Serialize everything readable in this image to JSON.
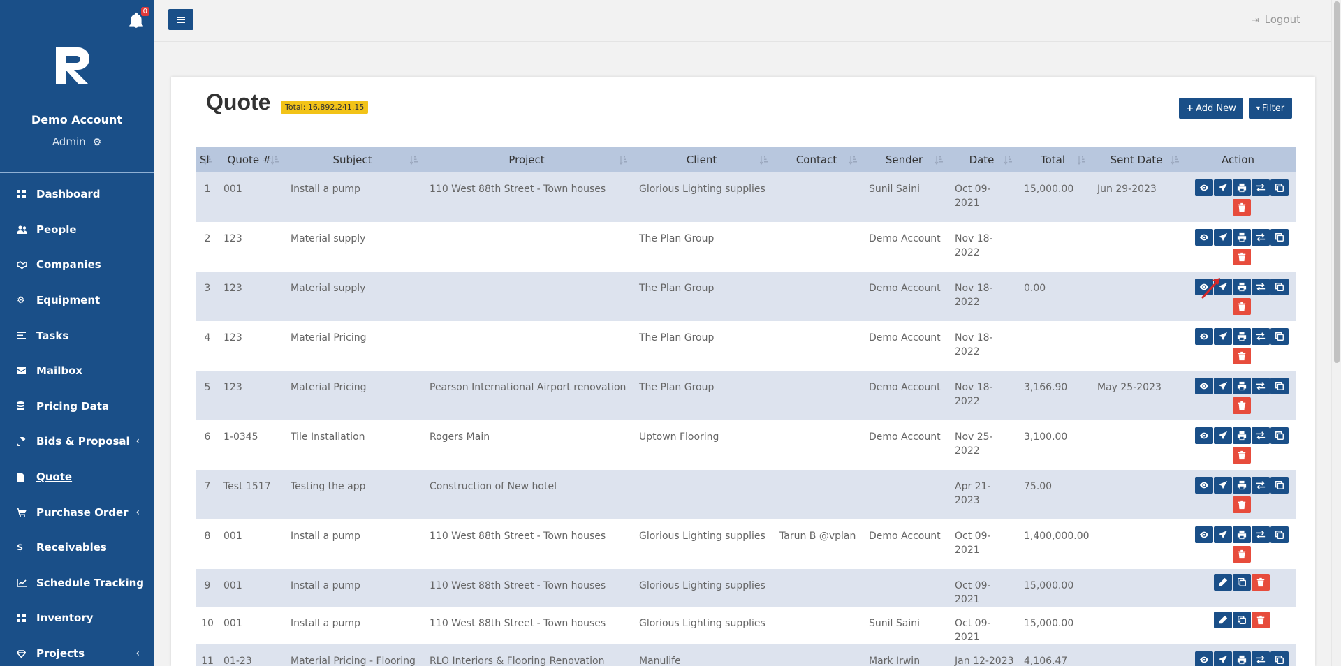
{
  "notifications": {
    "count": "0"
  },
  "account": {
    "name": "Demo Account",
    "role": "Admin"
  },
  "nav": [
    {
      "label": "Dashboard",
      "icon": "dashboard-icon"
    },
    {
      "label": "People",
      "icon": "people-icon"
    },
    {
      "label": "Companies",
      "icon": "handshake-icon"
    },
    {
      "label": "Equipment",
      "icon": "cog-icon"
    },
    {
      "label": "Tasks",
      "icon": "tasks-icon"
    },
    {
      "label": "Mailbox",
      "icon": "envelope-icon"
    },
    {
      "label": "Pricing Data",
      "icon": "database-icon"
    },
    {
      "label": "Bids & Proposal",
      "icon": "gavel-icon",
      "has_submenu": true
    },
    {
      "label": "Quote",
      "icon": "quote-icon",
      "active": true
    },
    {
      "label": "Purchase Order",
      "icon": "cart-icon",
      "has_submenu": true
    },
    {
      "label": "Receivables",
      "icon": "dollar-icon"
    },
    {
      "label": "Schedule Tracking",
      "icon": "chart-line-icon"
    },
    {
      "label": "Inventory",
      "icon": "grid-icon"
    },
    {
      "label": "Projects",
      "icon": "diamond-icon",
      "has_submenu": true
    }
  ],
  "topbar": {
    "logout_label": "Logout"
  },
  "page": {
    "title": "Quote",
    "total_label": "Total: 16,892,241.15",
    "add_new_label": "Add New",
    "filter_label": "Filter"
  },
  "table": {
    "columns": [
      "Sl",
      "Quote #",
      "Subject",
      "Project",
      "Client",
      "Contact",
      "Sender",
      "Date",
      "Total",
      "Sent Date",
      "Action"
    ],
    "rows": [
      {
        "sl": "1",
        "quote": "001",
        "subject": "Install a pump",
        "project": "110 West 88th Street - Town houses",
        "client": "Glorious Lighting supplies",
        "contact": "",
        "sender": "Sunil Saini",
        "date": "Oct 09-2021",
        "total": "15,000.00",
        "sent_date": "Jun 29-2023",
        "actions": "full"
      },
      {
        "sl": "2",
        "quote": "123",
        "subject": "Material supply",
        "project": "",
        "client": "The Plan Group",
        "contact": "",
        "sender": "Demo Account",
        "date": "Nov 18-2022",
        "total": "",
        "sent_date": "",
        "actions": "full"
      },
      {
        "sl": "3",
        "quote": "123",
        "subject": "Material supply",
        "project": "",
        "client": "The Plan Group",
        "contact": "",
        "sender": "Demo Account",
        "date": "Nov 18-2022",
        "total": "0.00",
        "sent_date": "",
        "actions": "full"
      },
      {
        "sl": "4",
        "quote": "123",
        "subject": "Material Pricing",
        "project": "",
        "client": "The Plan Group",
        "contact": "",
        "sender": "Demo Account",
        "date": "Nov 18-2022",
        "total": "",
        "sent_date": "",
        "actions": "full"
      },
      {
        "sl": "5",
        "quote": "123",
        "subject": "Material Pricing",
        "project": "Pearson International Airport renovation",
        "client": "The Plan Group",
        "contact": "",
        "sender": "Demo Account",
        "date": "Nov 18-2022",
        "total": "3,166.90",
        "sent_date": "May 25-2023",
        "actions": "full"
      },
      {
        "sl": "6",
        "quote": "1-0345",
        "subject": "Tile Installation",
        "project": "Rogers Main",
        "client": "Uptown Flooring",
        "contact": "",
        "sender": "Demo Account",
        "date": "Nov 25-2022",
        "total": "3,100.00",
        "sent_date": "",
        "actions": "full"
      },
      {
        "sl": "7",
        "quote": "Test 1517",
        "subject": "Testing the app",
        "project": "Construction of New hotel",
        "client": "",
        "contact": "",
        "sender": "",
        "date": "Apr 21-2023",
        "total": "75.00",
        "sent_date": "",
        "actions": "full"
      },
      {
        "sl": "8",
        "quote": "001",
        "subject": "Install a pump",
        "project": "110 West 88th Street - Town houses",
        "client": "Glorious Lighting supplies",
        "contact": "Tarun B @vplan",
        "sender": "Demo Account",
        "date": "Oct 09-2021",
        "total": "1,400,000.00",
        "sent_date": "",
        "actions": "full"
      },
      {
        "sl": "9",
        "quote": "001",
        "subject": "Install a pump",
        "project": "110 West 88th Street - Town houses",
        "client": "Glorious Lighting supplies",
        "contact": "",
        "sender": "",
        "date": "Oct 09-2021",
        "total": "15,000.00",
        "sent_date": "",
        "actions": "short"
      },
      {
        "sl": "10",
        "quote": "001",
        "subject": "Install a pump",
        "project": "110 West 88th Street - Town houses",
        "client": "Glorious Lighting supplies",
        "contact": "",
        "sender": "Sunil Saini",
        "date": "Oct 09-2021",
        "total": "15,000.00",
        "sent_date": "",
        "actions": "short"
      },
      {
        "sl": "11",
        "quote": "01-23",
        "subject": "Material Pricing - Flooring",
        "project": "RLO Interiors & Flooring Renovation",
        "client": "Manulife",
        "contact": "",
        "sender": "Mark Irwin",
        "date": "Jan 12-2023",
        "total": "4,106.47",
        "sent_date": "",
        "actions": "full"
      }
    ]
  },
  "colors": {
    "primary": "#1a4f88",
    "danger": "#e74c3c",
    "badge": "#f2c318",
    "row_stripe": "#dde3ee",
    "header": "#b8c7de",
    "annotation_arrow": "#d62828"
  }
}
